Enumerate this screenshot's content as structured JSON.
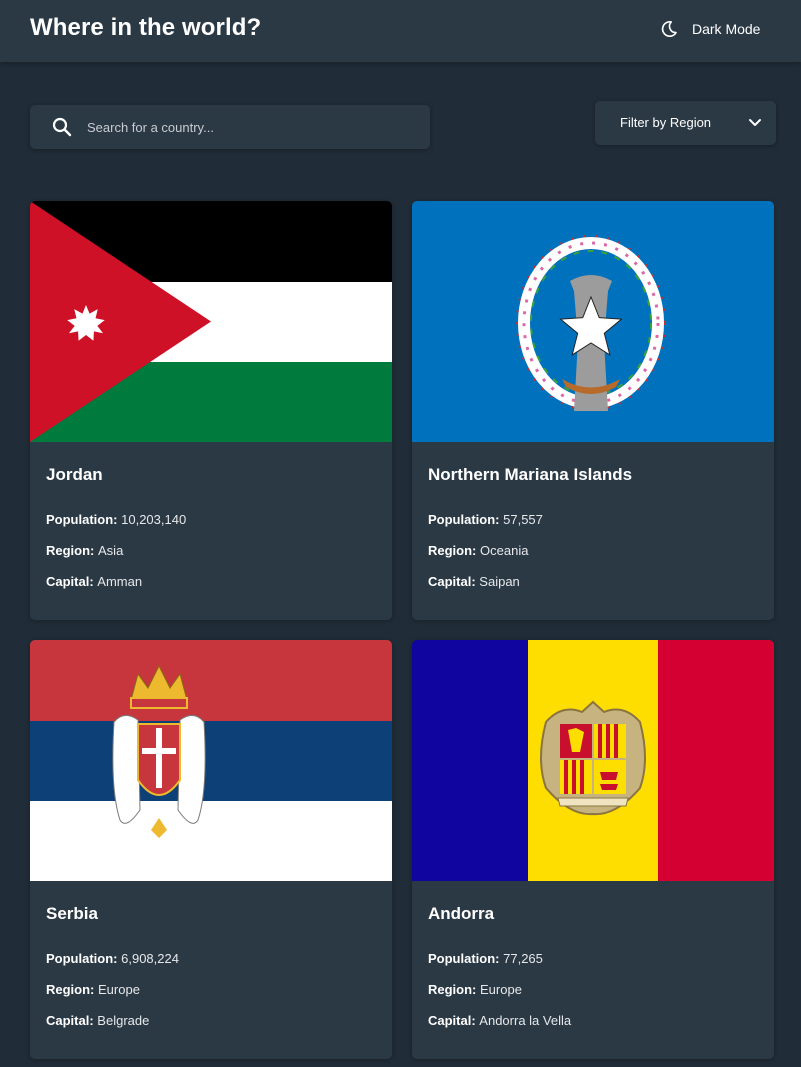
{
  "header": {
    "title": "Where in the world?",
    "dark_mode_label": "Dark Mode",
    "dark_mode_icon": "moon-icon"
  },
  "search": {
    "placeholder": "Search for a country...",
    "value": "",
    "icon": "search-icon"
  },
  "filter": {
    "label": "Filter by Region",
    "icon": "chevron-down-icon"
  },
  "labels": {
    "population": "Population:",
    "region": "Region:",
    "capital": "Capital:"
  },
  "countries": [
    {
      "name": "Jordan",
      "population": "10,203,140",
      "region": "Asia",
      "capital": "Amman",
      "flag": "jordan-flag"
    },
    {
      "name": "Northern Mariana Islands",
      "population": "57,557",
      "region": "Oceania",
      "capital": "Saipan",
      "flag": "northern-mariana-islands-flag"
    },
    {
      "name": "Serbia",
      "population": "6,908,224",
      "region": "Europe",
      "capital": "Belgrade",
      "flag": "serbia-flag"
    },
    {
      "name": "Andorra",
      "population": "77,265",
      "region": "Europe",
      "capital": "Andorra la Vella",
      "flag": "andorra-flag"
    }
  ],
  "colors": {
    "background": "#202c37",
    "element": "#2b3945",
    "text": "#ffffff"
  }
}
